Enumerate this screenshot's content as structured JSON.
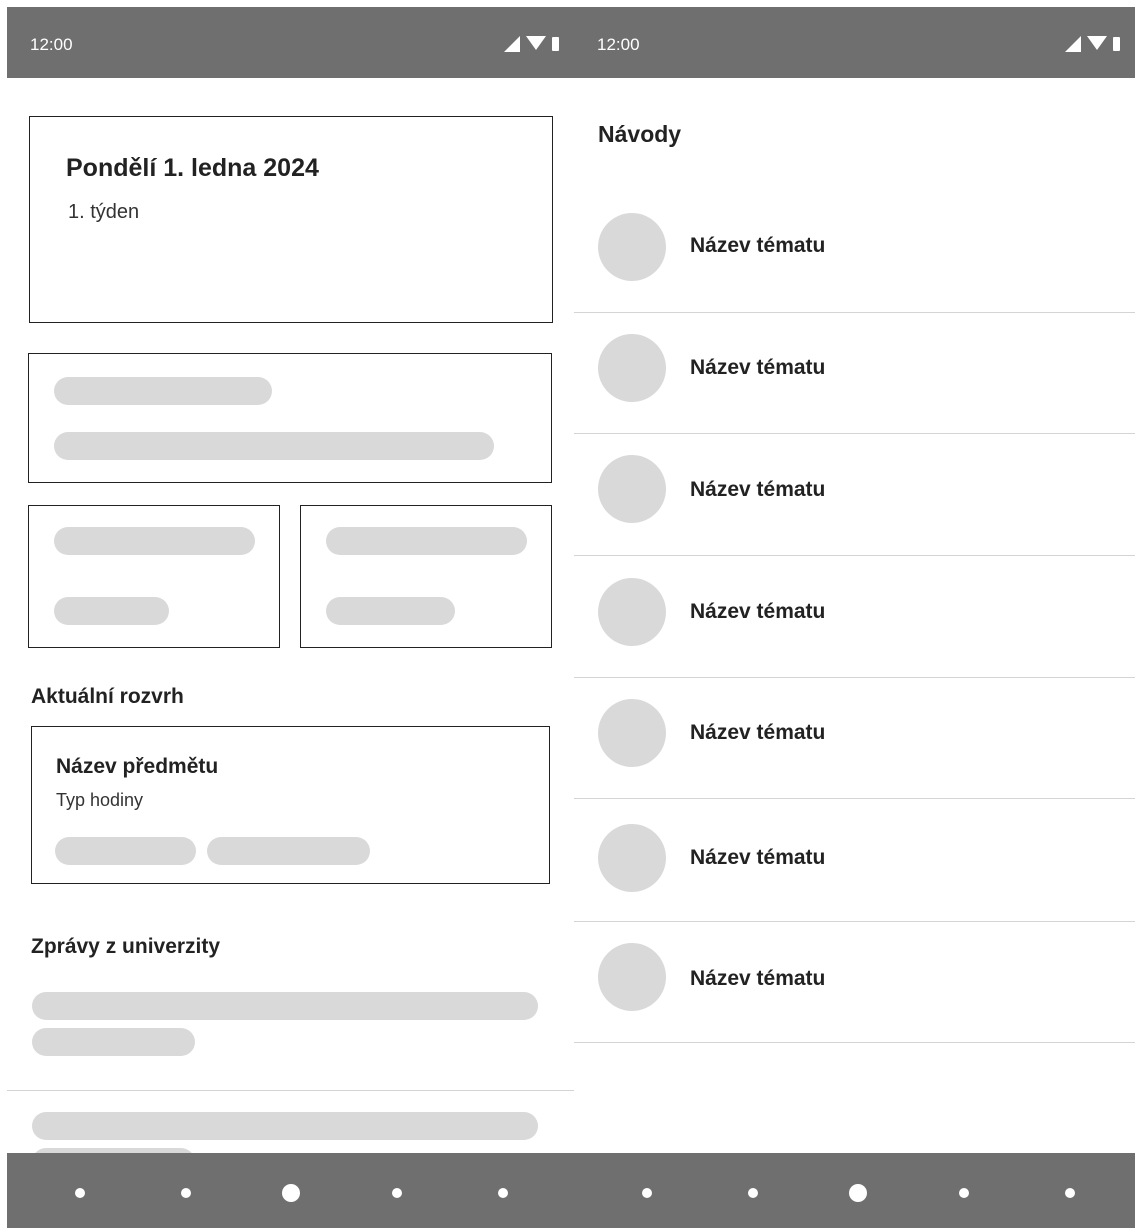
{
  "left_screen": {
    "status": {
      "time": "12:00"
    },
    "today": {
      "date": "Pondělí 1. ledna 2024",
      "week": "1. týden"
    },
    "schedule": {
      "section_title": "Aktuální rozvrh",
      "subject": "Název předmětu",
      "type": "Typ hodiny"
    },
    "news": {
      "section_title": "Zprávy z univerzity"
    }
  },
  "right_screen": {
    "status": {
      "time": "12:00"
    },
    "title": "Návody",
    "topics": [
      {
        "label": "Název tématu"
      },
      {
        "label": "Název tématu"
      },
      {
        "label": "Název tématu"
      },
      {
        "label": "Název tématu"
      },
      {
        "label": "Název tématu"
      },
      {
        "label": "Název tématu"
      },
      {
        "label": "Název tématu"
      }
    ]
  },
  "colors": {
    "system_bar": "#6f6f6f",
    "placeholder": "#d9d9d9",
    "divider": "#d4d4d4"
  },
  "icons": {
    "status": [
      "signal-icon",
      "wifi-icon",
      "battery-icon"
    ],
    "nav": [
      "nav-dot-icon",
      "nav-home-icon"
    ]
  }
}
